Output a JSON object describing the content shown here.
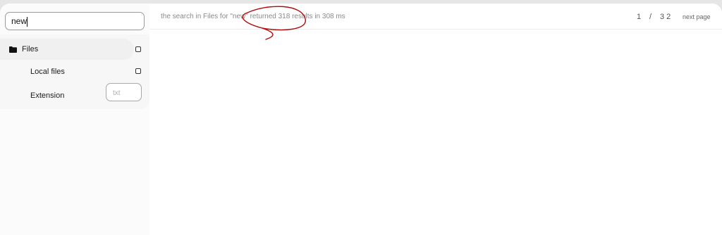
{
  "search": {
    "value": "new"
  },
  "sidebar": {
    "files_label": "Files",
    "local_files_label": "Local files",
    "extension_label": "Extension",
    "extension_placeholder": "txt"
  },
  "results": {
    "status_text": "the search in Files for \"new\" returned 318 results in 308 ms",
    "current_page": "1",
    "separator": "/",
    "total_pages": "32",
    "next_page_label": "next page"
  },
  "colors": {
    "annotation": "#b00c0c"
  }
}
